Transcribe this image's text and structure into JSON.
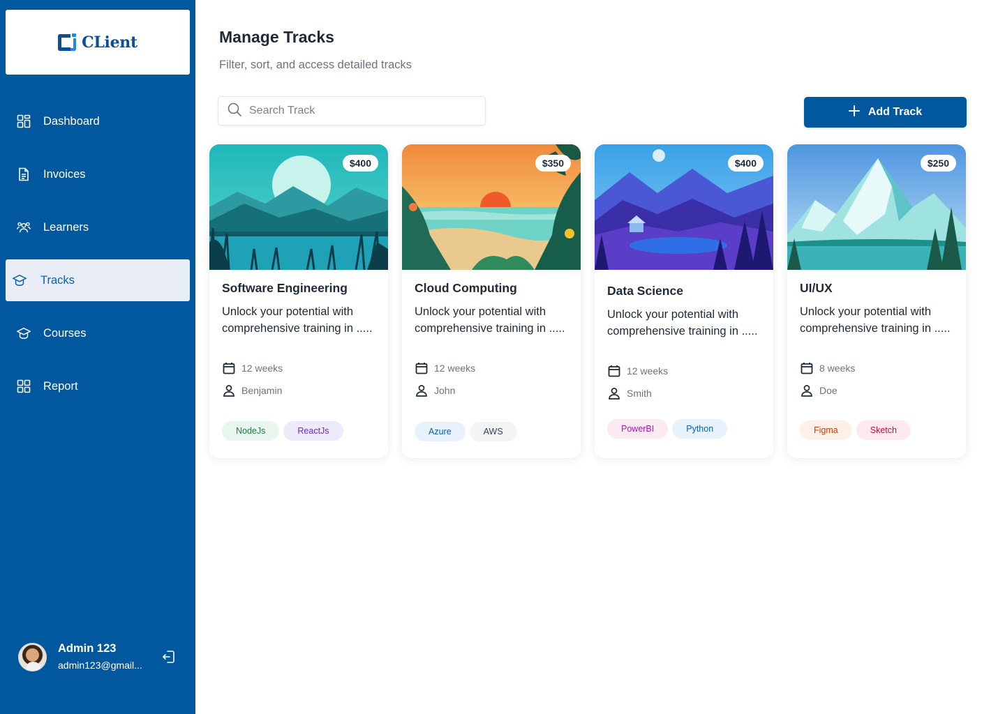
{
  "app": {
    "logo_text": "CLient"
  },
  "sidebar": {
    "items": [
      {
        "label": "Dashboard",
        "icon": "grid-icon"
      },
      {
        "label": "Invoices",
        "icon": "document-icon"
      },
      {
        "label": "Learners",
        "icon": "users-icon"
      },
      {
        "label": "Tracks",
        "icon": "graduation-cap-icon",
        "active": true
      },
      {
        "label": "Courses",
        "icon": "graduation-cap-icon"
      },
      {
        "label": "Report",
        "icon": "grid-icon"
      }
    ],
    "user": {
      "name": "Admin 123",
      "email": "admin123@gmail..."
    }
  },
  "header": {
    "title": "Manage Tracks",
    "subtitle": "Filter, sort, and access detailed tracks"
  },
  "search": {
    "placeholder": "Search Track",
    "value": ""
  },
  "add_button": {
    "label": "Add Track"
  },
  "cards": [
    {
      "title": "Software Engineering",
      "price": "$400",
      "description": "Unlock your potential with comprehensive training in .....",
      "duration": "12 weeks",
      "instructor": "Benjamin",
      "tags": [
        {
          "label": "NodeJs",
          "bg": "#e7f7ee",
          "fg": "#15803d"
        },
        {
          "label": "ReactJs",
          "bg": "#efeafb",
          "fg": "#6d28d9"
        }
      ]
    },
    {
      "title": "Cloud Computing",
      "price": "$350",
      "description": "Unlock your potential with comprehensive training in .....",
      "duration": "12 weeks",
      "instructor": "John",
      "tags": [
        {
          "label": "Azure",
          "bg": "#e8f2fd",
          "fg": "#0b5fa8"
        },
        {
          "label": "AWS",
          "bg": "#f3f4f6",
          "fg": "#374151"
        }
      ]
    },
    {
      "title": "Data Science",
      "price": "$400",
      "description": "Unlock your potential with comprehensive training in .....",
      "duration": "12 weeks",
      "instructor": "Smith",
      "tags": [
        {
          "label": "PowerBI",
          "bg": "#fbe9f3",
          "fg": "#a21caf"
        },
        {
          "label": "Python",
          "bg": "#e8f2fd",
          "fg": "#0b5fa8"
        }
      ]
    },
    {
      "title": "UI/UX",
      "price": "$250",
      "description": "Unlock your potential with comprehensive training in .....",
      "duration": "8 weeks",
      "instructor": "Doe",
      "tags": [
        {
          "label": "Figma",
          "bg": "#fdf0e8",
          "fg": "#c2410c"
        },
        {
          "label": "Sketch",
          "bg": "#fdeaf0",
          "fg": "#be123c"
        }
      ]
    }
  ],
  "colors": {
    "brand": "#01589f",
    "active_bg": "#e9eef6"
  }
}
